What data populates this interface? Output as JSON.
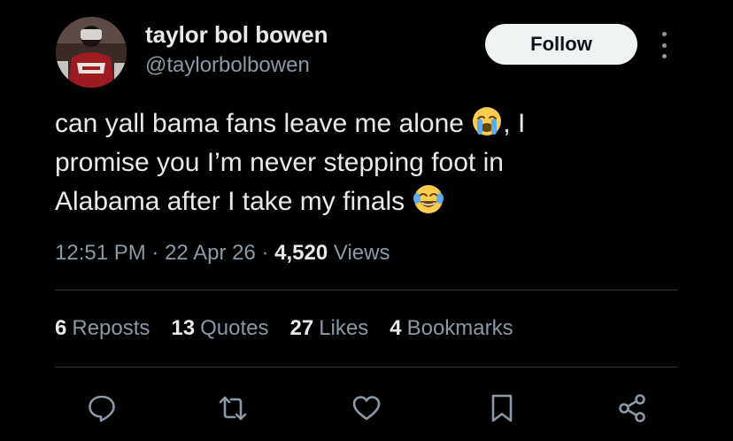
{
  "author": {
    "display_name": "taylor bol bowen",
    "handle": "@taylorbolbowen",
    "avatar_icon": "profile-photo"
  },
  "follow_label": "Follow",
  "tweet": {
    "line1_text": "can yall bama fans leave me alone ",
    "line1_emoji": "loudly-crying-face",
    "line1_after": ", I",
    "line2_text": "promise you I’m never stepping foot in",
    "line3_text": "Alabama after I take my finals ",
    "line3_emoji": "face-with-tears-of-joy"
  },
  "meta": {
    "time": "12:51 PM",
    "sep1": " · ",
    "date": "22 Apr 26",
    "sep2": " · ",
    "views_count": "4,520",
    "views_label": " Views"
  },
  "stats": {
    "reposts_count": "6",
    "reposts_label": "Reposts",
    "quotes_count": "13",
    "quotes_label": "Quotes",
    "likes_count": "27",
    "likes_label": "Likes",
    "bookmarks_count": "4",
    "bookmarks_label": "Bookmarks"
  },
  "actions": [
    "reply-icon",
    "repost-icon",
    "like-icon",
    "bookmark-icon",
    "share-icon"
  ],
  "colors": {
    "background": "#000000",
    "text": "#e7e9ea",
    "secondary": "#8b98a5",
    "divider": "#2f3336",
    "follow_bg": "#eff3f4"
  }
}
